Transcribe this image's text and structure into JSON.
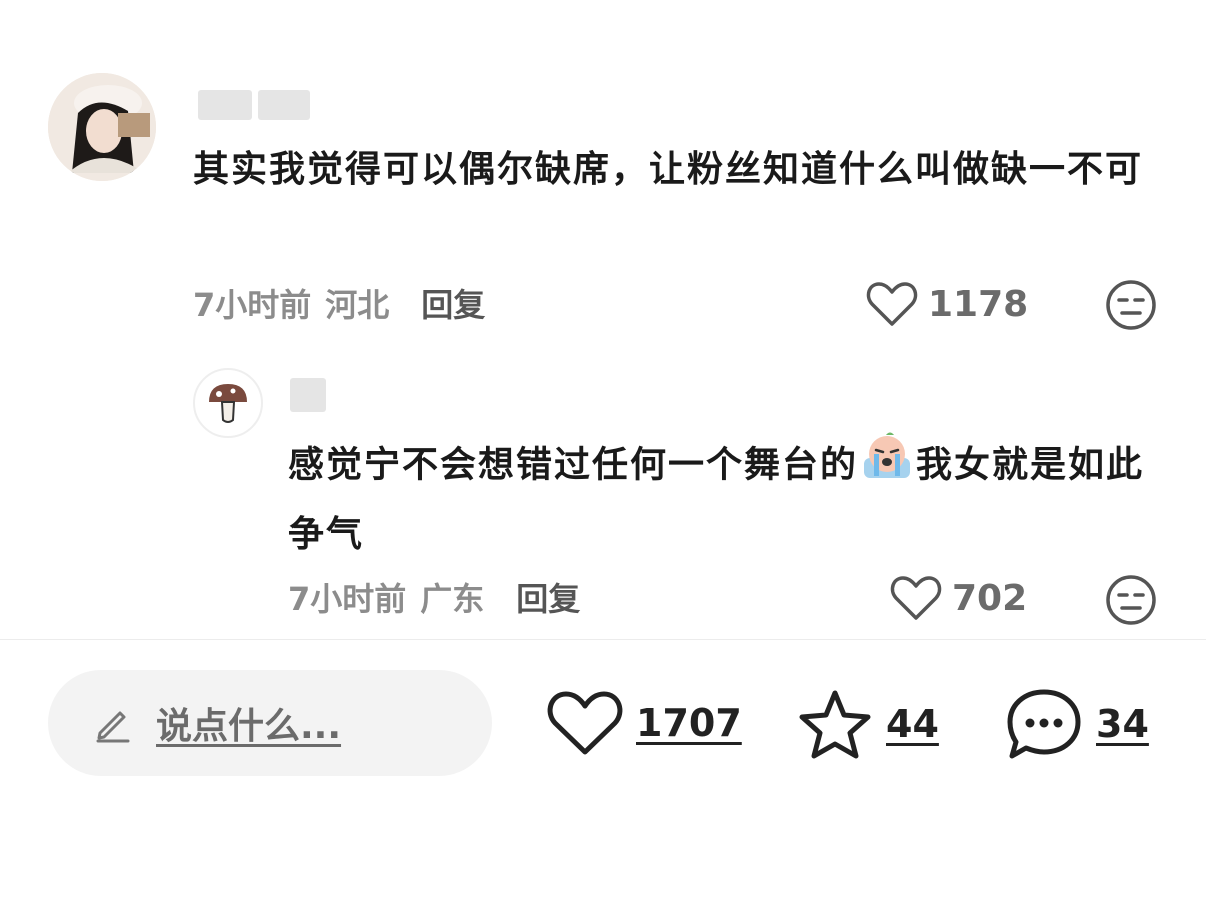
{
  "comments": [
    {
      "text_part1": "其实我觉得可以偶尔缺席，让粉丝知道什么叫做缺一不可",
      "time": "7小时前",
      "location": "河北",
      "reply_label": "回复",
      "likes": "1178"
    },
    {
      "text_part1": "感觉宁不会想错过任何一个舞台的",
      "emoji": "crying-face-emoji",
      "text_part2": "我女就是如此争气",
      "time": "7小时前",
      "location": "广东",
      "reply_label": "回复",
      "likes": "702"
    }
  ],
  "bottom_bar": {
    "input_placeholder": "说点什么...",
    "like_count": "1707",
    "favorite_count": "44",
    "comment_count": "34"
  },
  "colors": {
    "text_primary": "#1a1a1a",
    "text_meta": "#8c8c8c",
    "input_bg": "#f3f3f3",
    "divider": "#ececec"
  }
}
